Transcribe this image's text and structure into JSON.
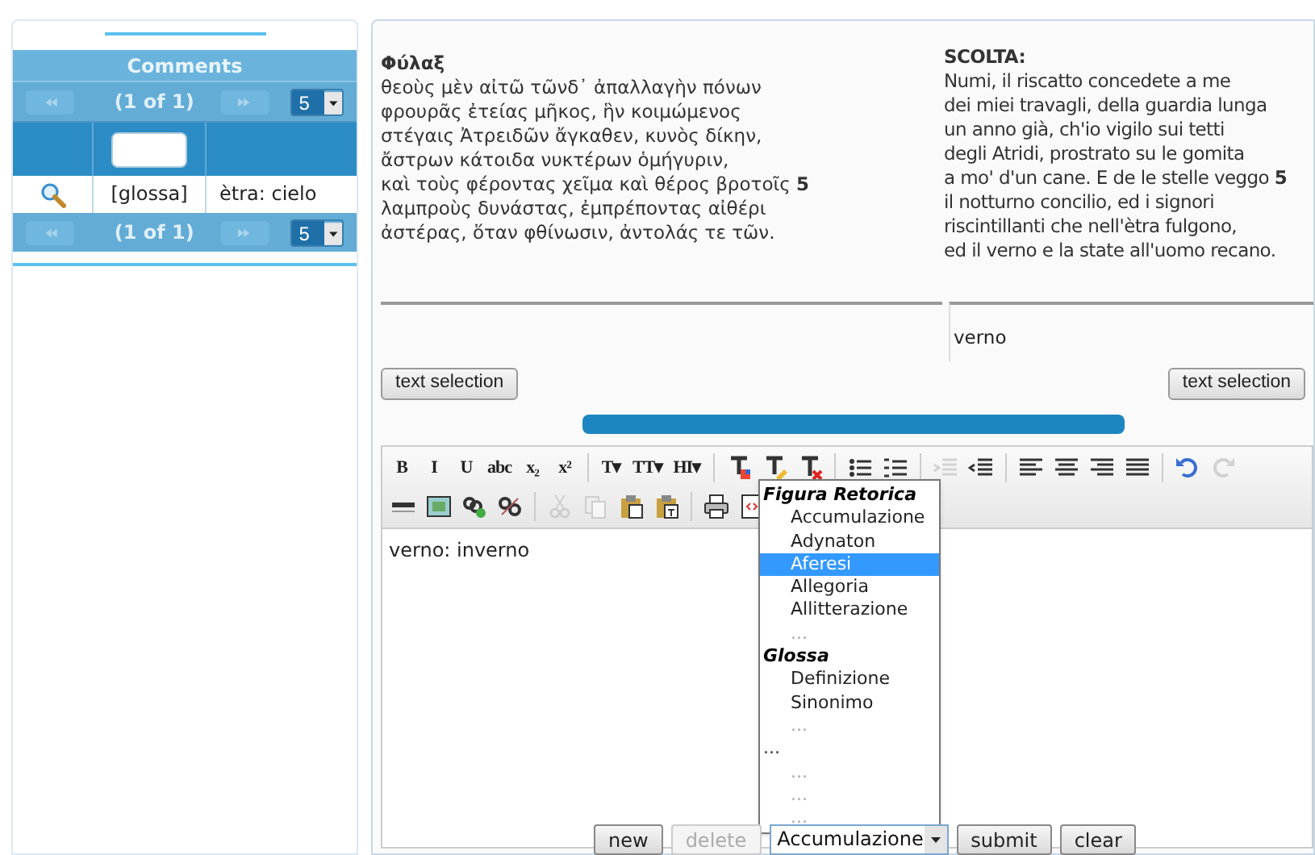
{
  "comments_panel": {
    "title": "Comments",
    "paginator_top": {
      "page": "(1 of 1)",
      "per_page": "5"
    },
    "rows": [
      {
        "column_2": "[glossa]",
        "column_3": "ètra: cielo"
      }
    ],
    "paginator_bottom": {
      "page": "(1 of 1)",
      "per_page": "5"
    }
  },
  "original": {
    "heading": "Φύλαξ",
    "lines": [
      "θεοὺς μὲν αἰτῶ τῶνδ᾽ ἀπαλλαγὴν πόνων",
      "φρουρᾶς ἐτείας μῆκος, ἣν κοιμώμενος",
      "στέγαις Ἀτρειδῶν ἄγκαθεν, κυνὸς δίκην,",
      "ἄστρων κάτοιδα νυκτέρων ὁμήγυριν,",
      "καὶ τοὺς φέροντας χεῖμα καὶ θέρος βροτοῖς **5**",
      "λαμπροὺς δυνάστας, ἐμπρέποντας αἰθέρι",
      "ἀστέρας, ὅταν φθίνωσιν, ἀντολάς τε τῶν."
    ]
  },
  "translation": {
    "heading": "SCOLTA:",
    "lines": [
      "Numi, il riscatto concedete a me",
      "dei miei travagli, della guardia lunga",
      "un anno già, ch'io vigilo sui tetti",
      "degli Atridi, prostrato su le gomita",
      "a mo' d'un cane. E de le stelle veggo **5**",
      "il notturno concilio, ed i signori",
      "riscintillanti che nell'ètra fulgono,",
      "ed il verno e la state all'uomo recano."
    ],
    "selection": "verno"
  },
  "selection_buttons": [
    "text selection",
    "text selection"
  ],
  "toolbar": [
    [
      {
        "kind": "glyph",
        "label": "B"
      },
      {
        "kind": "glyph",
        "label": "I"
      },
      {
        "kind": "glyph",
        "label": "U"
      },
      {
        "kind": "glyph",
        "label": "abc"
      },
      {
        "kind": "glyph",
        "label": "x₂"
      },
      {
        "kind": "glyph",
        "label": "x²"
      },
      {
        "kind": "sep"
      },
      {
        "kind": "glyph",
        "label": "T▾"
      },
      {
        "kind": "glyph",
        "label": "TT▾"
      },
      {
        "kind": "glyph",
        "label": "HI▾"
      },
      {
        "kind": "sep"
      },
      {
        "kind": "icon",
        "disabled": false
      },
      {
        "kind": "icon",
        "disabled": false
      },
      {
        "kind": "icon",
        "disabled": false
      },
      {
        "kind": "sep"
      },
      {
        "kind": "icon",
        "disabled": false
      },
      {
        "kind": "icon",
        "disabled": false
      },
      {
        "kind": "sep"
      },
      {
        "kind": "icon",
        "disabled": true
      },
      {
        "kind": "icon",
        "disabled": false
      },
      {
        "kind": "sep"
      },
      {
        "kind": "icon",
        "disabled": false
      },
      {
        "kind": "icon",
        "disabled": false
      },
      {
        "kind": "icon",
        "disabled": false
      },
      {
        "kind": "icon",
        "disabled": false
      },
      {
        "kind": "sep"
      },
      {
        "kind": "icon",
        "disabled": false
      },
      {
        "kind": "icon",
        "disabled": true
      }
    ],
    [
      {
        "kind": "icon",
        "disabled": false
      },
      {
        "kind": "icon",
        "disabled": false
      },
      {
        "kind": "icon",
        "disabled": false
      },
      {
        "kind": "icon",
        "disabled": false
      },
      {
        "kind": "sep"
      },
      {
        "kind": "icon",
        "disabled": true
      },
      {
        "kind": "icon",
        "disabled": true
      },
      {
        "kind": "icon",
        "disabled": false
      },
      {
        "kind": "icon",
        "disabled": false
      },
      {
        "kind": "sep"
      },
      {
        "kind": "icon",
        "disabled": false
      },
      {
        "kind": "icon",
        "disabled": false
      }
    ]
  ],
  "editor": {
    "value": "verno: inverno"
  },
  "dropdown": {
    "options": [
      {
        "kind": "group",
        "label": "Figura Retorica"
      },
      {
        "kind": "option",
        "label": "Accumulazione",
        "selected": false,
        "disabled": false
      },
      {
        "kind": "option",
        "label": "Adynaton",
        "selected": false,
        "disabled": false
      },
      {
        "kind": "option",
        "label": "Aferesi",
        "selected": true,
        "disabled": false
      },
      {
        "kind": "option",
        "label": "Allegoria",
        "selected": false,
        "disabled": false
      },
      {
        "kind": "option",
        "label": "Allitterazione",
        "selected": false,
        "disabled": false
      },
      {
        "kind": "option",
        "label": "...",
        "selected": false,
        "disabled": true
      },
      {
        "kind": "group",
        "label": "Glossa"
      },
      {
        "kind": "option",
        "label": "Definizione",
        "selected": false,
        "disabled": false
      },
      {
        "kind": "option",
        "label": "Sinonimo",
        "selected": false,
        "disabled": false
      },
      {
        "kind": "option",
        "label": "...",
        "selected": false,
        "disabled": true
      },
      {
        "kind": "plain",
        "label": "..."
      },
      {
        "kind": "option",
        "label": "...",
        "selected": false,
        "disabled": true
      },
      {
        "kind": "option",
        "label": "...",
        "selected": false,
        "disabled": true
      },
      {
        "kind": "option",
        "label": "...",
        "selected": false,
        "disabled": true
      }
    ]
  },
  "actions": [
    {
      "kind": "button",
      "label": "new",
      "disabled": false
    },
    {
      "kind": "button",
      "label": "delete",
      "disabled": true
    },
    {
      "kind": "select",
      "label": "Accumulazione"
    },
    {
      "kind": "button",
      "label": "submit",
      "disabled": false
    },
    {
      "kind": "button",
      "label": "clear",
      "disabled": false
    }
  ]
}
